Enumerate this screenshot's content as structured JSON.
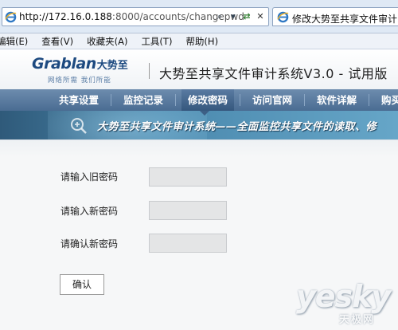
{
  "browser": {
    "address_bar": {
      "url_host": "http://172.16.0.188",
      "url_path": ":8000/accounts/changepwd",
      "icon": "ie-icon",
      "controls": [
        "search-dropdown-icon",
        "go-icon",
        "refresh-icon",
        "stop-icon"
      ]
    },
    "tab": {
      "title": "修改大势至共享文件审计系...",
      "icon": "ie-icon"
    },
    "menu": [
      "编辑(E)",
      "查看(V)",
      "收藏夹(A)",
      "工具(T)",
      "帮助(H)"
    ]
  },
  "header": {
    "logo_text": "Grablan",
    "logo_cn": "大势至",
    "slogan": "网络所需   我们所能",
    "system_title": "大势至共享文件审计系统V3.0 - 试用版"
  },
  "nav": {
    "items": [
      {
        "label": "共享设置"
      },
      {
        "label": "监控记录"
      },
      {
        "label": "修改密码",
        "active": true
      },
      {
        "label": "访问官网"
      },
      {
        "label": "软件详解"
      },
      {
        "label": "购买"
      }
    ]
  },
  "banner": {
    "text": "大势至共享文件审计系统——全面监控共享文件的读取、修",
    "icon": "zoom-icon"
  },
  "form": {
    "old_password_label": "请输入旧密码",
    "new_password_label": "请输入新密码",
    "confirm_password_label": "请确认新密码",
    "submit_label": "确认"
  },
  "watermark": {
    "en": "yesky",
    "cn": "天极网"
  },
  "colors": {
    "nav_bg": "#5a7ba2",
    "banner_bg": "#4a88ad",
    "brand": "#1d4a80",
    "chrome_bg": "#dfe9f5"
  }
}
